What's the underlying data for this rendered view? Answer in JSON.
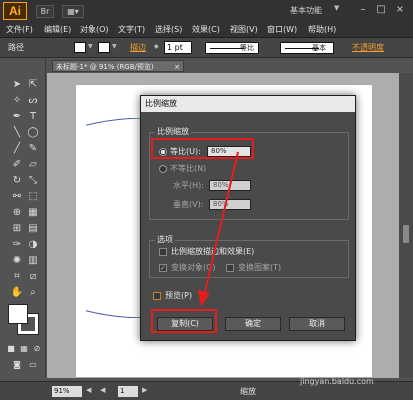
{
  "app": {
    "logo": "Ai"
  },
  "titlebar": {
    "workspace": "基本功能",
    "workspace_arrow": "▼",
    "btn_br": "Br",
    "btn_view": "▦▾",
    "minimize": "–",
    "maximize": "□",
    "close": "×"
  },
  "menu": [
    "文件(F)",
    "编辑(E)",
    "对象(O)",
    "文字(T)",
    "选择(S)",
    "效果(C)",
    "视图(V)",
    "窗口(W)",
    "帮助(H)"
  ],
  "control_bar": {
    "path_label": "路径",
    "stroke_label": "描边",
    "stroke_value": "1 pt",
    "profile_label": "等比",
    "brush_label": "基本",
    "opacity_label": "不透明度"
  },
  "document": {
    "tab": "未标题-1* @ 91% (RGB/预览)",
    "close_icon": "×"
  },
  "status": {
    "zoom": "91%",
    "page": "1",
    "status_text": "缩放"
  },
  "dialog": {
    "title": "比例缩放",
    "scale_group": "比例缩放",
    "uniform_label": "等比(U):",
    "uniform_value": "80%",
    "nonuniform_label": "不等比(N)",
    "horizontal_label": "水平(H):",
    "horizontal_value": "80%",
    "vertical_label": "垂直(V):",
    "vertical_value": "80%",
    "options_group": "选项",
    "scale_strokes": "比例缩放描边和效果(E)",
    "transform_objects": "变换对象(O)",
    "transform_patterns": "变换图案(T)",
    "preview": "预览(P)",
    "copy_button": "复制(C)",
    "ok_button": "确定",
    "cancel_button": "取消"
  },
  "watermark": "jingyan.baidu.com",
  "colors": {
    "annotation_red": "#e31e1e",
    "ai_orange": "#f7a21b",
    "ellipse_stroke": "#4b5fa8"
  }
}
